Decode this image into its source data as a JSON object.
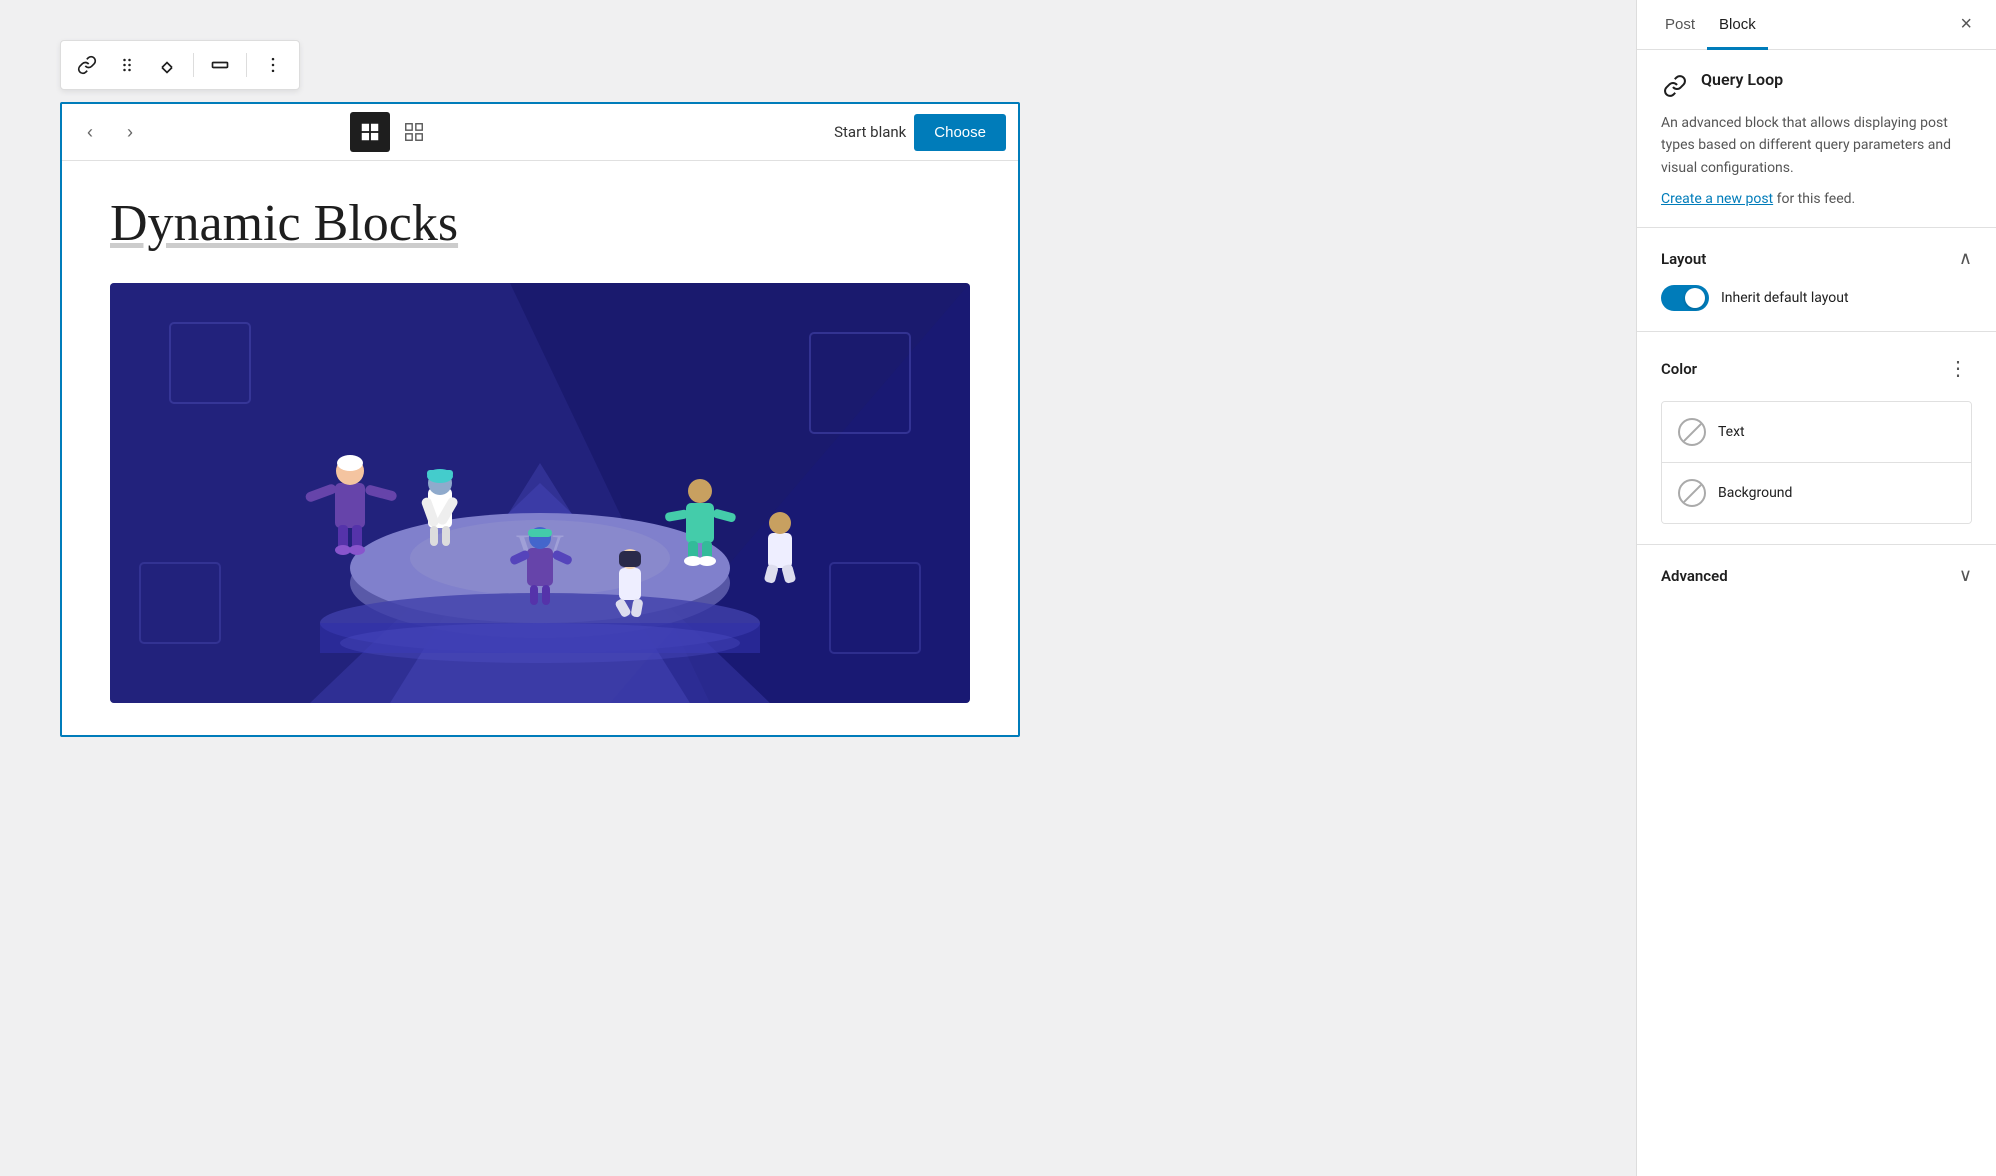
{
  "editor": {
    "toolbar": {
      "link_icon": "⌗",
      "drag_icon": "⠿",
      "move_icon": "↕",
      "align_icon": "▬",
      "more_icon": "⋮"
    },
    "block": {
      "nav_prev": "‹",
      "nav_next": "›",
      "start_blank_label": "Start blank",
      "choose_button": "Choose",
      "title": "Dynamic Blocks"
    }
  },
  "sidebar": {
    "tabs": [
      {
        "id": "post",
        "label": "Post",
        "active": false
      },
      {
        "id": "block",
        "label": "Block",
        "active": true
      }
    ],
    "close_label": "×",
    "block_info": {
      "name": "Query Loop",
      "description": "An advanced block that allows displaying post types based on different query parameters and visual configurations.",
      "create_post_link": "Create a new post",
      "feed_text": " for this feed."
    },
    "layout": {
      "title": "Layout",
      "inherit_label": "Inherit default layout",
      "toggle_on": true
    },
    "color": {
      "title": "Color",
      "options": [
        {
          "id": "text",
          "label": "Text"
        },
        {
          "id": "background",
          "label": "Background"
        }
      ]
    },
    "advanced": {
      "title": "Advanced"
    }
  },
  "colors": {
    "primary": "#007cba",
    "active_tab_border": "#007cba"
  }
}
